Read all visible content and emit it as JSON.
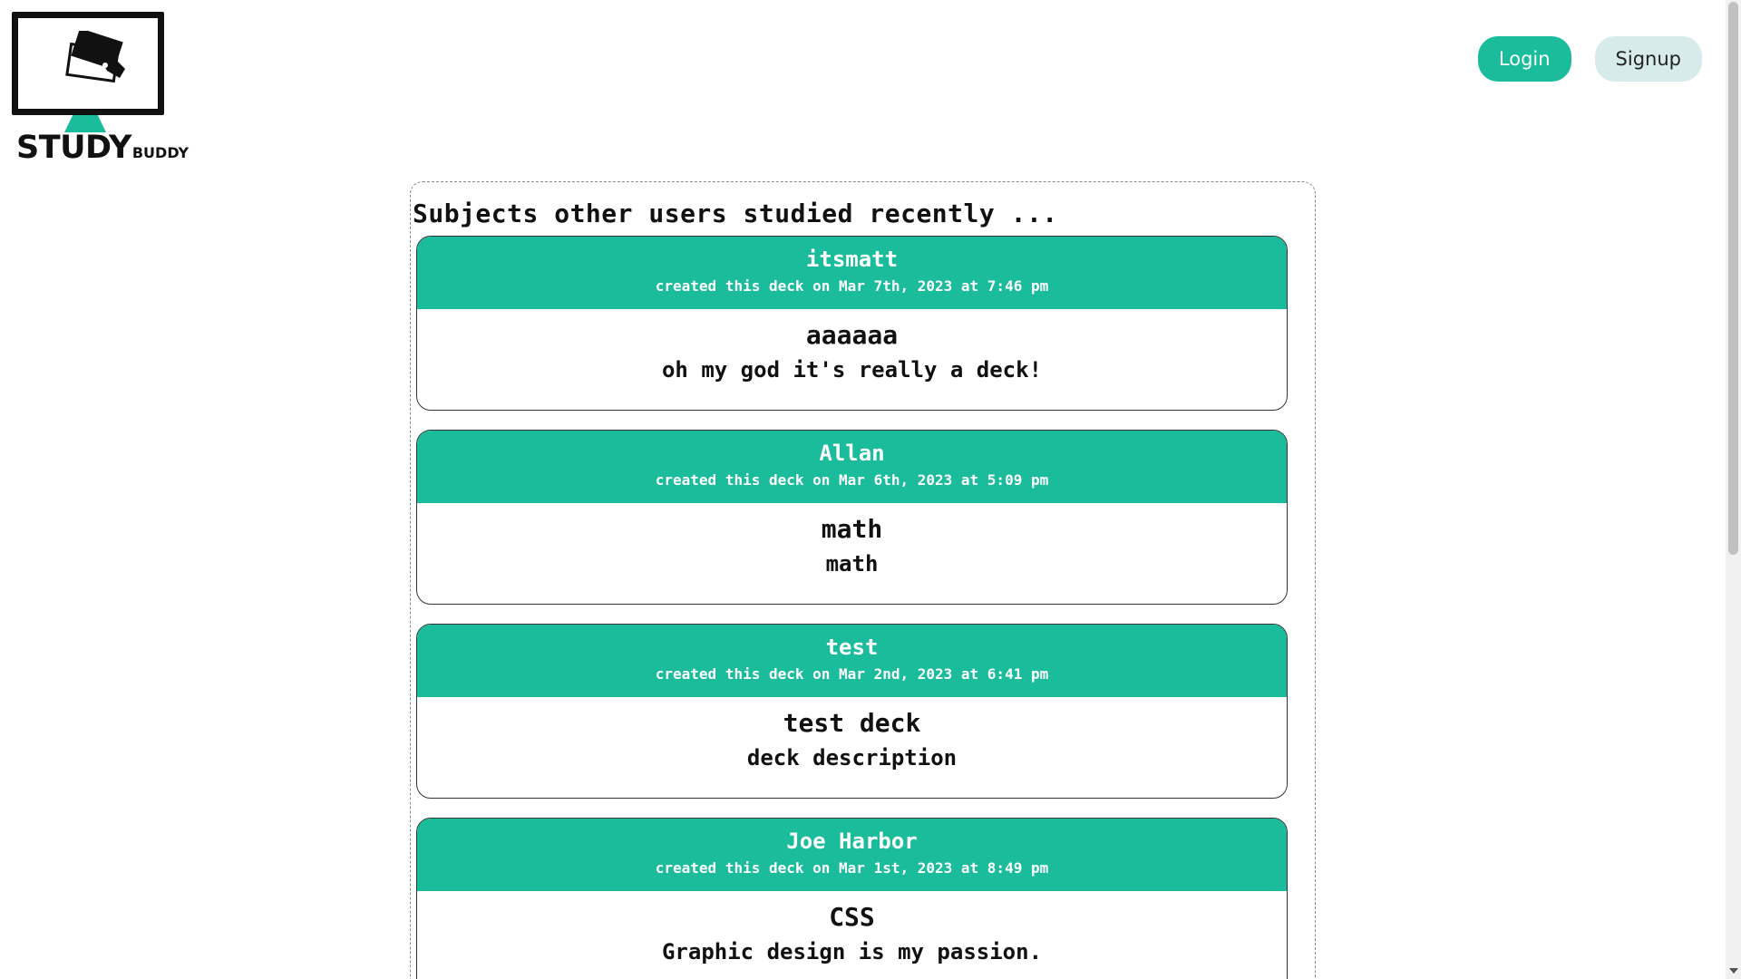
{
  "logo": {
    "text_big": "STUDY",
    "text_small": "BUDDY",
    "accent_color": "#1abc9c",
    "icon": "monitor-with-cards-icon"
  },
  "nav": {
    "login_label": "Login",
    "signup_label": "Signup"
  },
  "feed": {
    "title": "Subjects other users studied recently ...",
    "decks": [
      {
        "user": "itsmatt",
        "meta": "created this deck on Mar 7th, 2023 at 7:46 pm",
        "name": "aaaaaa",
        "description": "oh my god it's really a deck!"
      },
      {
        "user": "Allan",
        "meta": "created this deck on Mar 6th, 2023 at 5:09 pm",
        "name": "math",
        "description": "math"
      },
      {
        "user": "test",
        "meta": "created this deck on Mar 2nd, 2023 at 6:41 pm",
        "name": "test deck",
        "description": "deck description"
      },
      {
        "user": "Joe Harbor",
        "meta": "created this deck on Mar 1st, 2023 at 8:49 pm",
        "name": "CSS",
        "description": "Graphic design is my passion."
      }
    ]
  },
  "colors": {
    "primary": "#1abc9c",
    "secondary_button": "#d7ecea"
  }
}
